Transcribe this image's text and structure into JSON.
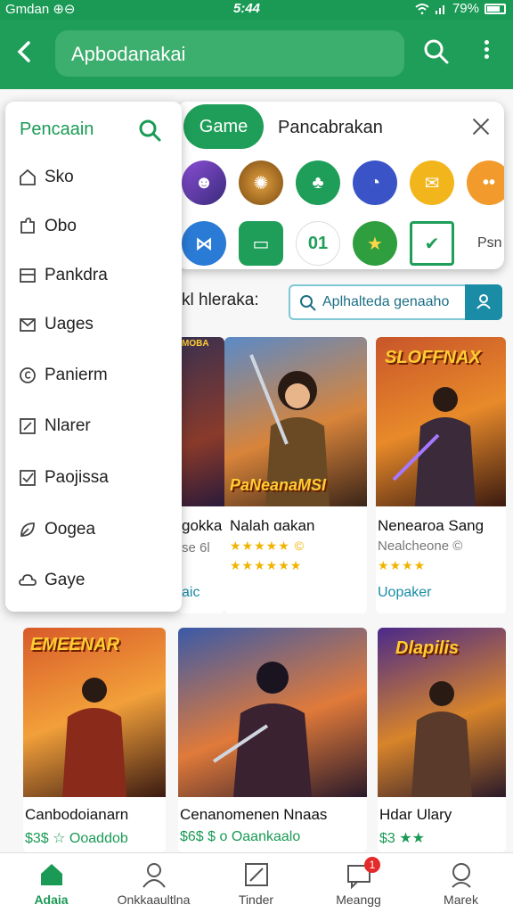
{
  "status_bar": {
    "left": "Gmdan ⊕⊖",
    "time": "5:44",
    "battery": "79%"
  },
  "app_bar": {
    "search_text": "Apbodanakai"
  },
  "drawer": {
    "title": "Pencaain",
    "items": [
      {
        "label": "Sko",
        "icon": "home-icon"
      },
      {
        "label": "Obo",
        "icon": "puzzle-icon"
      },
      {
        "label": "Pankdra",
        "icon": "panel-icon"
      },
      {
        "label": "Uages",
        "icon": "mail-icon"
      },
      {
        "label": "Panierm",
        "icon": "copyright-icon"
      },
      {
        "label": "Nlarer",
        "icon": "edit-icon"
      },
      {
        "label": "Paojissa",
        "icon": "checkbox-icon"
      },
      {
        "label": "Oogea",
        "icon": "leaf-icon"
      },
      {
        "label": "Gaye",
        "icon": "cloud-icon"
      }
    ]
  },
  "panel": {
    "chip": "Game",
    "title": "Pancabrakan",
    "more": "Psn",
    "icons_row1": [
      "avatar-icon",
      "globe-icon",
      "people-icon",
      "compass-icon",
      "ticket-icon",
      "face-icon"
    ],
    "icons_row2": [
      "bow-icon",
      "tv-icon",
      "a01-icon",
      "star-icon",
      "check-icon"
    ],
    "icon_a01_label": "01"
  },
  "section": {
    "label": "kl hleraka:",
    "search_text": "Aplhalteda genaaho"
  },
  "cards_row1": [
    {
      "art_title": "",
      "art_badge": "MOBA",
      "name": "gokka",
      "sub": "se 6l",
      "stars": "",
      "tag": "aic"
    },
    {
      "art_title": "PaNeanaMSI",
      "art_badge": "",
      "name": "Nalah ɑakan",
      "sub": "",
      "stars": "★★★★★ ©",
      "stars2": "★★★★★★",
      "tag": ""
    },
    {
      "art_title": "SLOFFNAX",
      "art_badge": "",
      "name": "Nenearoa Sang",
      "sub": "Nealcheᴏne ©",
      "stars": "★★★★",
      "tag": "Uopaker"
    }
  ],
  "cards_row2": [
    {
      "art_title": "EMEENAR",
      "name": "Canbodoianarn",
      "price": "$3$ ☆ Ooaddob"
    },
    {
      "art_title": "",
      "name": "Cenanomenen Nnaas",
      "price": "$6$ $ o Oaankaalo"
    },
    {
      "art_title": "Dlapilis",
      "name": "Hdar Ulary",
      "price": "$3 ★★"
    }
  ],
  "bottom_nav": [
    {
      "label": "Adaia",
      "icon": "home-icon",
      "active": true
    },
    {
      "label": "Onkkaaultlna",
      "icon": "person-icon",
      "active": false
    },
    {
      "label": "Tinder",
      "icon": "edit-icon",
      "active": false
    },
    {
      "label": "Meangg",
      "icon": "message-icon",
      "active": false,
      "badge": "1"
    },
    {
      "label": "Marek",
      "icon": "person-outline-icon",
      "active": false
    }
  ],
  "colors": {
    "brand_green": "#1e9e58",
    "accent_teal": "#1a8ca6",
    "badge_red": "#e52a2a",
    "star_gold": "#f0b400"
  }
}
